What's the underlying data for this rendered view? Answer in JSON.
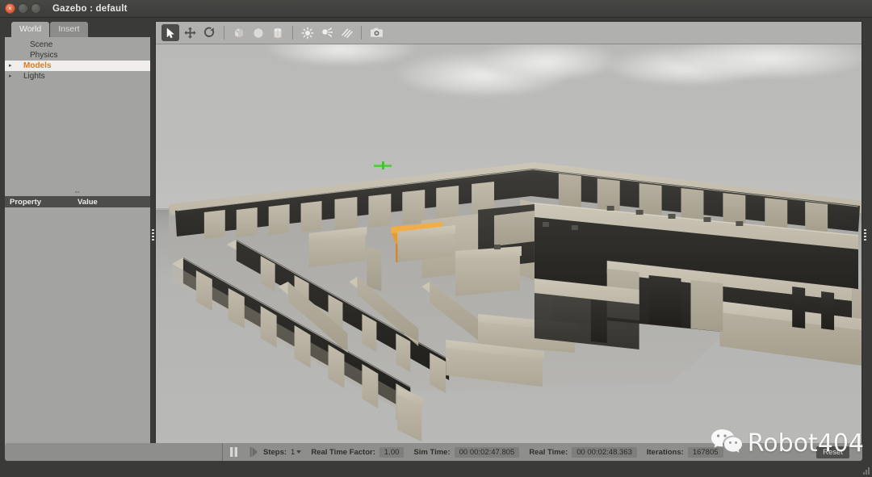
{
  "window": {
    "title": "Gazebo : default",
    "buttons": {
      "close": "×",
      "minimize": "−",
      "maximize": "□"
    }
  },
  "left_panel": {
    "tabs": [
      {
        "label": "World",
        "active": true
      },
      {
        "label": "Insert",
        "active": false
      }
    ],
    "tree": [
      {
        "label": "Scene",
        "arrow": "",
        "selected": false
      },
      {
        "label": "Physics",
        "arrow": "",
        "selected": false
      },
      {
        "label": "Models",
        "arrow": "▸",
        "selected": true
      },
      {
        "label": "Lights",
        "arrow": "▸",
        "selected": false
      }
    ],
    "property_table": {
      "col_property": "Property",
      "col_value": "Value"
    },
    "splitter_grip": "▪▪"
  },
  "toolbar": {
    "items": [
      {
        "name": "select-arrow-icon",
        "active": true
      },
      {
        "name": "translate-move-icon",
        "active": false
      },
      {
        "name": "rotate-icon",
        "active": false
      },
      {
        "name": "separator",
        "active": false
      },
      {
        "name": "insert-box-icon",
        "active": false
      },
      {
        "name": "insert-sphere-icon",
        "active": false
      },
      {
        "name": "insert-cylinder-icon",
        "active": false
      },
      {
        "name": "separator",
        "active": false
      },
      {
        "name": "point-light-icon",
        "active": false
      },
      {
        "name": "spot-light-icon",
        "active": false
      },
      {
        "name": "directional-light-icon",
        "active": false
      },
      {
        "name": "separator",
        "active": false
      },
      {
        "name": "screenshot-camera-icon",
        "active": false
      }
    ]
  },
  "status_bar": {
    "pause_icon": "pause-icon",
    "step_icon": "step-forward-icon",
    "steps_label": "Steps:",
    "steps_value": "1",
    "real_time_factor_label": "Real Time Factor:",
    "real_time_factor_value": "1.00",
    "sim_time_label": "Sim Time:",
    "sim_time_value": "00 00:02:47.805",
    "real_time_label": "Real Time:",
    "real_time_value": "00 00:02:48.363",
    "iterations_label": "Iterations:",
    "iterations_value": "167805",
    "reset_label": "Reset"
  },
  "watermark": {
    "icon": "wechat-logo-icon",
    "text": "Robot404"
  },
  "scene": {
    "description": "3D office building floorplan with tan walls on a grey ground plane under an overcast sky",
    "origin_marker": "green-axis-marker",
    "colors": {
      "sky": "#bcbcba",
      "ground": "#b4b4b2",
      "wall_top": "#c9c2b3",
      "wall_face_light": "#b8b1a2",
      "wall_face_dark": "#2b2a27",
      "highlight_object": "#e08b2a"
    }
  }
}
